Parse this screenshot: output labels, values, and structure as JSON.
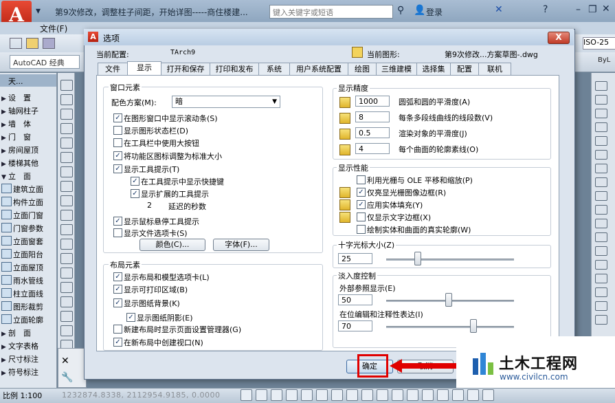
{
  "app": {
    "title": "第9次修改，调整柱子间距，开始详图-----商住楼建...",
    "search_placeholder": "键入关键字或短语",
    "login_label": "登录",
    "menu_file": "文件(F)",
    "workspace": "AutoCAD 经典",
    "iso_label": "ISO-25",
    "bylayer": "ByL"
  },
  "palette": {
    "header": "天...",
    "items": [
      {
        "label": "设　置",
        "icon": "arrow"
      },
      {
        "label": "轴网柱子",
        "icon": "arrow"
      },
      {
        "label": "墙　体",
        "icon": "arrow"
      },
      {
        "label": "门　窗",
        "icon": "arrow"
      },
      {
        "label": "房间屋顶",
        "icon": "arrow"
      },
      {
        "label": "楼梯其他",
        "icon": "arrow"
      },
      {
        "label": "立　面",
        "icon": "arrow-down"
      },
      {
        "label": "建筑立面",
        "icon": "tool"
      },
      {
        "label": "构件立面",
        "icon": "tool"
      },
      {
        "label": "立面门窗",
        "icon": "tool"
      },
      {
        "label": "门窗参数",
        "icon": "tool"
      },
      {
        "label": "立面窗套",
        "icon": "tool"
      },
      {
        "label": "立面阳台",
        "icon": "tool"
      },
      {
        "label": "立面屋顶",
        "icon": "tool"
      },
      {
        "label": "雨水管线",
        "icon": "tool"
      },
      {
        "label": "柱立面线",
        "icon": "tool"
      },
      {
        "label": "图形裁剪",
        "icon": "tool"
      },
      {
        "label": "立面轮廓",
        "icon": "tool"
      },
      {
        "label": "剖　面",
        "icon": "arrow"
      },
      {
        "label": "文字表格",
        "icon": "arrow"
      },
      {
        "label": "尺寸标注",
        "icon": "arrow"
      },
      {
        "label": "符号标注",
        "icon": "arrow"
      }
    ]
  },
  "status": {
    "scale": "比例 1:100",
    "coords": "1232874.8338, 2112954.9185, 0.0000"
  },
  "dialog": {
    "title": "选项",
    "close": "X",
    "profile_label": "当前配置:",
    "profile_value": "TArch9",
    "drawing_label": "当前图形:",
    "drawing_value": "第9次修改...方案草图-.dwg",
    "tabs": [
      "文件",
      "显示",
      "打开和保存",
      "打印和发布",
      "系统",
      "用户系统配置",
      "绘图",
      "三维建模",
      "选择集",
      "配置",
      "联机"
    ],
    "active_tab": 1,
    "window_elements": {
      "title": "窗口元素",
      "color_scheme_label": "配色方案(M):",
      "color_scheme_value": "暗",
      "options": [
        {
          "label": "在图形窗口中显示滚动条(S)",
          "checked": true
        },
        {
          "label": "显示图形状态栏(D)",
          "checked": false
        },
        {
          "label": "在工具栏中使用大按钮",
          "checked": false
        },
        {
          "label": "将功能区图标调整为标准大小",
          "checked": true
        },
        {
          "label": "显示工具提示(T)",
          "checked": true
        },
        {
          "label": "在工具提示中显示快捷键",
          "checked": true
        },
        {
          "label": "显示扩展的工具提示",
          "checked": true
        },
        {
          "label": "显示鼠标悬停工具提示",
          "checked": true
        },
        {
          "label": "显示文件选项卡(S)",
          "checked": false
        }
      ],
      "delay_value": "2",
      "delay_label": "延迟的秒数",
      "colors_button": "颜色(C)...",
      "fonts_button": "字体(F)..."
    },
    "layout_elements": {
      "title": "布局元素",
      "options": [
        {
          "label": "显示布局和模型选项卡(L)",
          "checked": true
        },
        {
          "label": "显示可打印区域(B)",
          "checked": true
        },
        {
          "label": "显示图纸背景(K)",
          "checked": true
        },
        {
          "label": "显示图纸阴影(E)",
          "checked": true
        },
        {
          "label": "新建布局时显示页面设置管理器(G)",
          "checked": false
        },
        {
          "label": "在新布局中创建视口(N)",
          "checked": true
        }
      ]
    },
    "display_resolution": {
      "title": "显示精度",
      "items": [
        {
          "value": "1000",
          "label": "圆弧和圆的平滑度(A)"
        },
        {
          "value": "8",
          "label": "每条多段线曲线的线段数(V)"
        },
        {
          "value": "0.5",
          "label": "渲染对象的平滑度(J)"
        },
        {
          "value": "4",
          "label": "每个曲面的轮廓素线(O)"
        }
      ]
    },
    "display_performance": {
      "title": "显示性能",
      "options": [
        {
          "label": "利用光栅与 OLE 平移和缩放(P)",
          "checked": false
        },
        {
          "label": "仅亮显光栅图像边框(R)",
          "checked": true
        },
        {
          "label": "应用实体填充(Y)",
          "checked": true
        },
        {
          "label": "仅显示文字边框(X)",
          "checked": false
        },
        {
          "label": "绘制实体和曲面的真实轮廓(W)",
          "checked": false
        }
      ]
    },
    "crosshair": {
      "title": "十字光标大小(Z)",
      "value": "25",
      "slider_fraction": 0.25
    },
    "fade": {
      "title": "淡入度控制",
      "xref_label": "外部参照显示(E)",
      "xref_value": "50",
      "xref_fraction": 0.5,
      "inplace_label": "在位编辑和注释性表达(I)",
      "inplace_value": "70",
      "inplace_fraction": 0.7
    },
    "ok_button": "确定",
    "cancel_button": "取消"
  },
  "watermark": {
    "title": "土木工程网",
    "url": "www.civilcn.com"
  }
}
